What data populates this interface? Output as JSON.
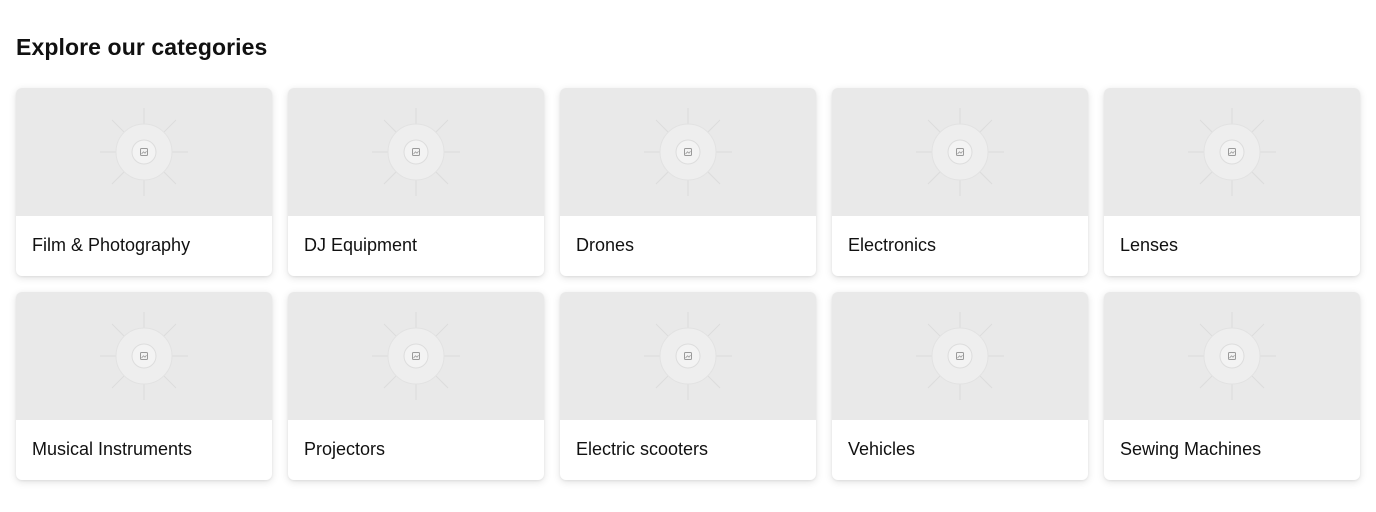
{
  "section": {
    "title": "Explore our categories"
  },
  "categories": [
    {
      "label": "Film & Photography",
      "icon": "image-placeholder-icon"
    },
    {
      "label": "DJ Equipment",
      "icon": "image-placeholder-icon"
    },
    {
      "label": "Drones",
      "icon": "image-placeholder-icon"
    },
    {
      "label": "Electronics",
      "icon": "image-placeholder-icon"
    },
    {
      "label": "Lenses",
      "icon": "image-placeholder-icon"
    },
    {
      "label": "Musical Instruments",
      "icon": "image-placeholder-icon"
    },
    {
      "label": "Projectors",
      "icon": "image-placeholder-icon"
    },
    {
      "label": "Electric scooters",
      "icon": "image-placeholder-icon"
    },
    {
      "label": "Vehicles",
      "icon": "image-placeholder-icon"
    },
    {
      "label": "Sewing Machines",
      "icon": "image-placeholder-icon"
    }
  ],
  "colors": {
    "thumb_background": "#e9e9e9",
    "card_background": "#ffffff",
    "text": "#111111"
  }
}
